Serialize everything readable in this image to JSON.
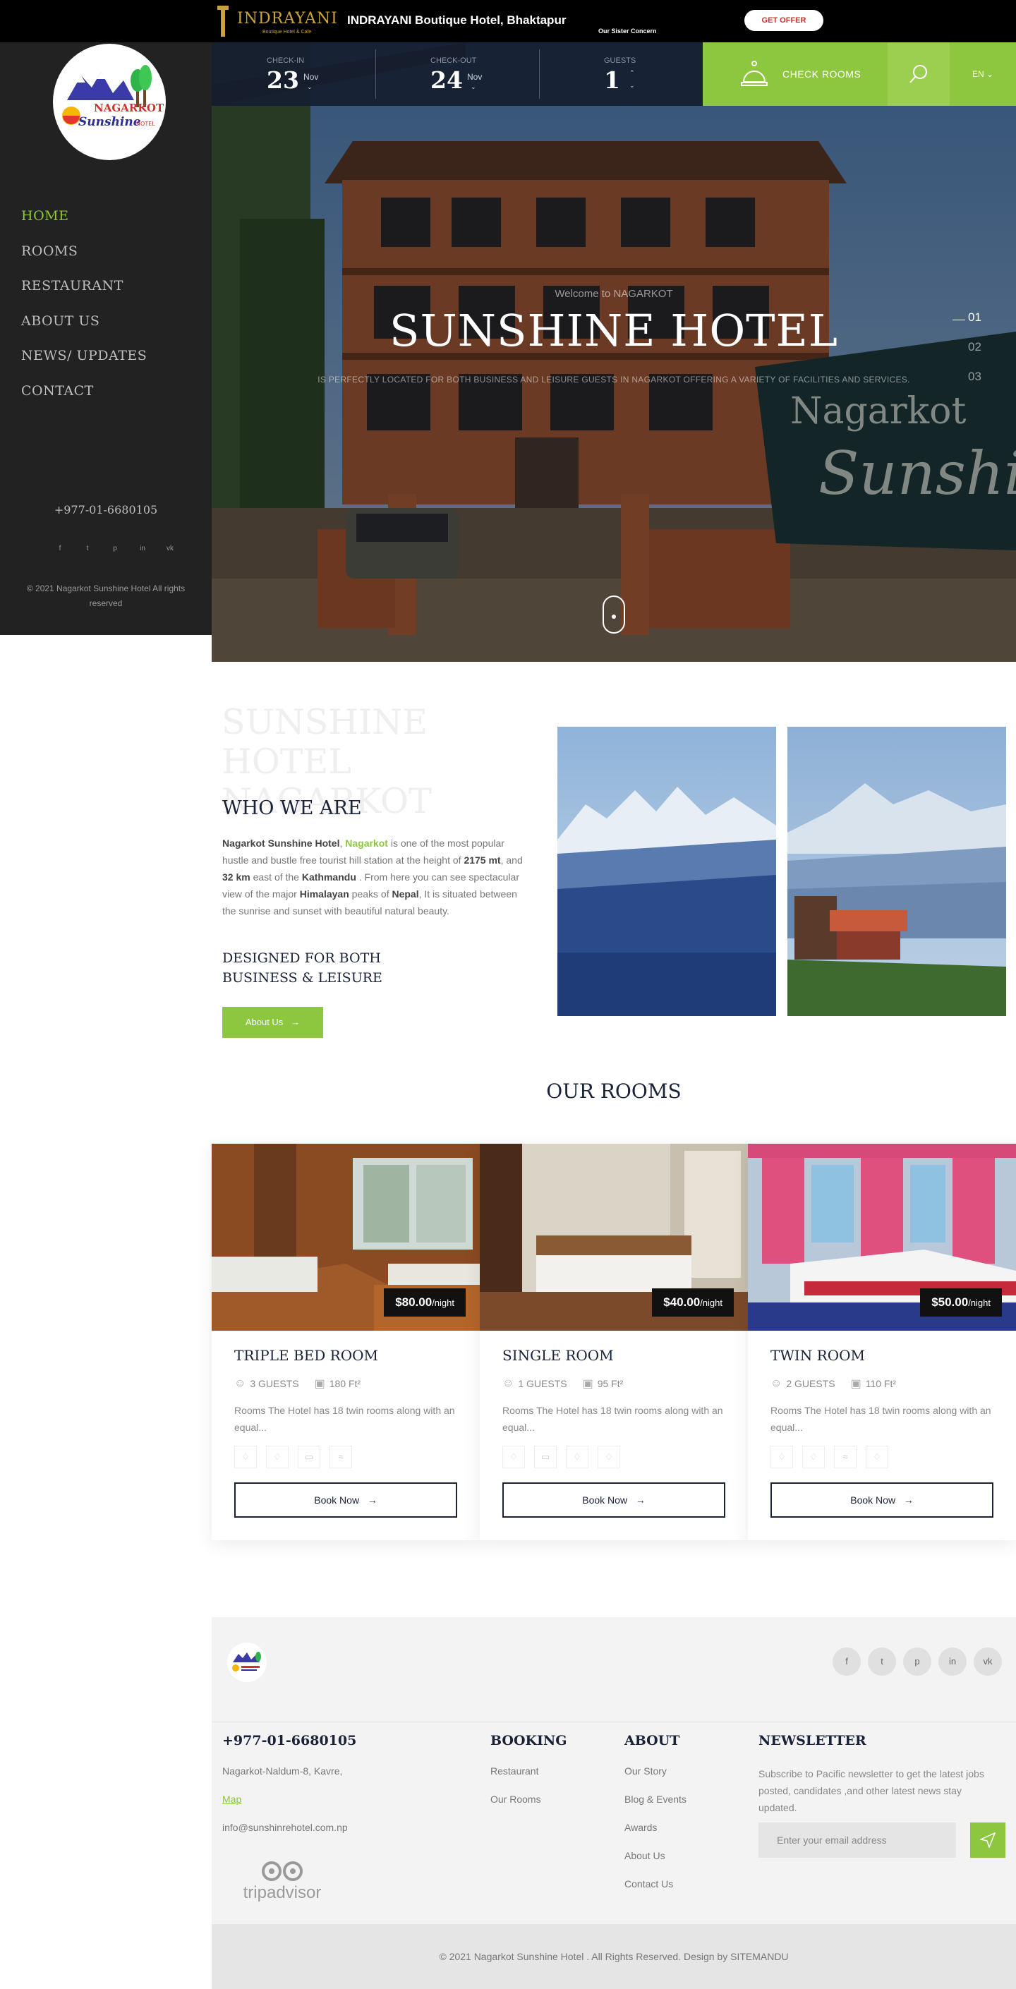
{
  "topbar": {
    "logo_text": "INDRAYANI",
    "logo_sub": "Boutique Hotel & Cafe",
    "title": "INDRAYANI Boutique Hotel, Bhaktapur",
    "subtitle": "Our Sister Concern",
    "offer_button": "GET OFFER"
  },
  "sidebar": {
    "logo_text_top": "NAGARKOT",
    "logo_text_bottom": "Sunshine",
    "logo_text_hotel": "HOTEL",
    "nav": [
      "HOME",
      "ROOMS",
      "RESTAURANT",
      "ABOUT US",
      "NEWS/ UPDATES",
      "CONTACT"
    ],
    "active_nav": "HOME",
    "phone": "+977-01-6680105",
    "social": [
      "f",
      "t",
      "p",
      "in",
      "vk"
    ],
    "copyright": "© 2021 Nagarkot Sunshine Hotel All rights reserved"
  },
  "booking": {
    "checkin_label": "CHECK-IN",
    "checkin_day": "23",
    "checkin_month": "Nov",
    "checkout_label": "CHECK-OUT",
    "checkout_day": "24",
    "checkout_month": "Nov",
    "guests_label": "GUESTS",
    "guests_value": "1",
    "check_rooms": "CHECK ROOMS",
    "language": "EN"
  },
  "hero": {
    "welcome": "Welcome to NAGARKOT",
    "title": "SUNSHINE HOTEL",
    "description": "IS PERFECTLY LOCATED FOR BOTH BUSINESS AND LEISURE GUESTS IN NAGARKOT OFFERING A VARIETY OF FACILITIES AND SERVICES.",
    "slides": [
      "01",
      "02",
      "03"
    ],
    "active_slide": "01"
  },
  "about": {
    "big_title": "SUNSHINE HOTEL NAGARKOT",
    "heading": "WHO WE ARE",
    "p_name": "Nagarkot Sunshine Hotel",
    "p_sep": ", ",
    "p_place": "Nagarkot",
    "p_1": " is one of the most popular hustle and bustle free tourist hill station at the height of ",
    "p_height": "2175 mt",
    "p_2": ", and ",
    "p_dist": "32 km",
    "p_3": " east of the ",
    "p_city": "Kathmandu",
    "p_4": " . From here you can see spectacular view of the major ",
    "p_mount": "Himalayan",
    "p_5": " peaks of ",
    "p_country": "Nepal",
    "p_6": ", It is situated between the sunrise and sunset with beautiful natural beauty.",
    "subheading": "DESIGNED FOR BOTH BUSINESS & LEISURE",
    "button": "About Us"
  },
  "rooms": {
    "title": "OUR ROOMS",
    "items": [
      {
        "name": "TRIPLE BED ROOM",
        "price": "$80.00",
        "per": "/night",
        "guests": "3 GUESTS",
        "area": "180 Ft²",
        "desc": "Rooms The Hotel has 18 twin rooms along with an equal...",
        "book": "Book Now"
      },
      {
        "name": "SINGLE ROOM",
        "price": "$40.00",
        "per": "/night",
        "guests": "1 GUESTS",
        "area": "95 Ft²",
        "desc": "Rooms The Hotel has 18 twin rooms along with an equal...",
        "book": "Book Now"
      },
      {
        "name": "TWIN ROOM",
        "price": "$50.00",
        "per": "/night",
        "guests": "2 GUESTS",
        "area": "110 Ft²",
        "desc": "Rooms The Hotel has 18 twin rooms along with an equal...",
        "book": "Book Now"
      }
    ]
  },
  "footer": {
    "social": [
      "f",
      "t",
      "p",
      "in",
      "vk"
    ],
    "contact": {
      "phone": "+977-01-6680105",
      "address": "Nagarkot-Naldum-8, Kavre,",
      "map": "Map",
      "email": "info@sunshinrehotel.com.np"
    },
    "booking": {
      "title": "BOOKING",
      "items": [
        "Restaurant",
        "Our Rooms"
      ]
    },
    "about": {
      "title": "ABOUT",
      "items": [
        "Our Story",
        "Blog & Events",
        "Awards",
        "About Us",
        "Contact Us"
      ]
    },
    "newsletter": {
      "title": "NEWSLETTER",
      "text": "Subscribe to Pacific newsletter to get the latest jobs posted, candidates ,and other latest news stay updated.",
      "placeholder": "Enter your email address"
    },
    "tripadvisor": "tripadvisor",
    "copyright": "© 2021 Nagarkot Sunshine Hotel . All Rights Reserved. Design by SITEMANDU"
  },
  "colors": {
    "accent": "#8dc63f",
    "dark": "#1a2238",
    "sidebar": "#222222"
  }
}
